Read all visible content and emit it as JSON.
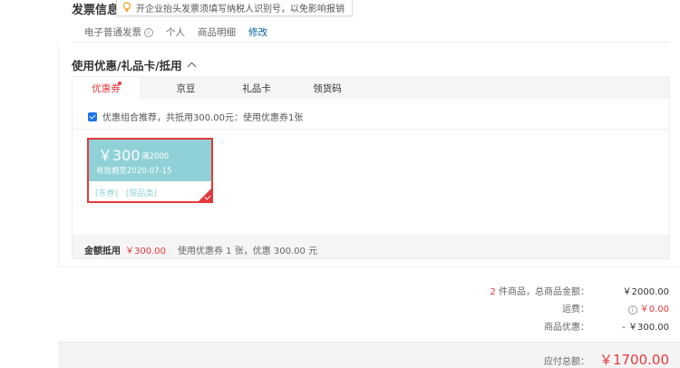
{
  "invoice": {
    "title": "发票信息",
    "tip": "开企业抬头发票须填写纳税人识别号，以免影响报销",
    "type": "电子普通发票",
    "info_glyph": "i",
    "header": "个人",
    "content": "商品明细",
    "modify": "修改"
  },
  "coupon_section": {
    "title": "使用优惠/礼品卡/抵用",
    "tabs": [
      "优惠券",
      "京豆",
      "礼品卡",
      "领货码"
    ],
    "active_tab": 0,
    "recommend_text": "优惠组合推荐，共抵用300.00元：使用优惠券1张",
    "coupon": {
      "amount": "￥300",
      "condition": "满2000",
      "validity": "有效期至2020-07-15",
      "tag1": "[东券]",
      "tag2": "[限品类]"
    },
    "summary": {
      "label": "金额抵用",
      "amount": "￥300.00",
      "detail": "使用优惠券 1 张，优惠 300.00 元"
    }
  },
  "totals": {
    "count": "2",
    "goods_label": "件商品，总商品金额：",
    "goods_value": "￥2000.00",
    "shipping_label": "运费：",
    "shipping_info_glyph": "i",
    "shipping_value": "￥0.00",
    "discount_label": "商品优惠：",
    "discount_value": "- ￥300.00",
    "pay_label": "应付总额：",
    "pay_value": "￥1700.00"
  },
  "colors": {
    "accent_red": "#e4393c",
    "coupon_teal": "#8fd1d6",
    "link_blue": "#005ea7"
  },
  "icons": {
    "tip": "lightbulb-icon",
    "collapse": "chevron-up-icon"
  }
}
